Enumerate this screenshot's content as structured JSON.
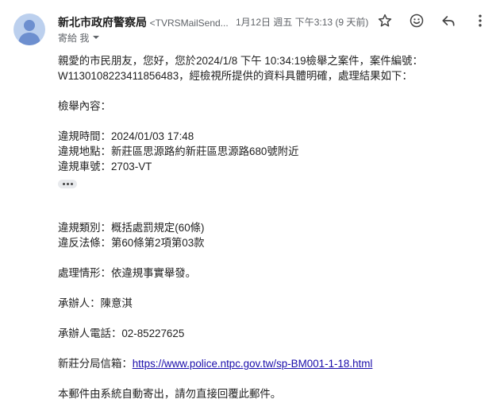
{
  "header": {
    "sender_name": "新北市政府警察局",
    "sender_email": "<TVRSMailSend...",
    "date": "1月12日 週五 下午3:13 (9 天前)",
    "to_label": "寄給 我",
    "icons": [
      "star-icon",
      "emoji-icon",
      "reply-icon",
      "more-vert-icon"
    ]
  },
  "body": {
    "greeting_line1": "親愛的市民朋友，您好，您於2024/1/8 下午 10:34:19檢舉之案件，案件編號：",
    "greeting_line2": "W1130108223411856483，經檢視所提供的資料具體明確，處理結果如下：",
    "report_heading": "檢舉內容：",
    "violation_time": "違規時間：2024/01/03 17:48",
    "violation_location": "違規地點：新莊區思源路約新莊區思源路680號附近",
    "violation_plate": "違規車號：2703-VT",
    "violation_category": "違規類別：概括處罰規定(60條)",
    "violation_law": "違反法條：第60條第2項第03款",
    "handling": "處理情形：依違規事實舉發。",
    "handler": "承辦人：陳意淇",
    "handler_phone": "承辦人電話：02-85227625",
    "branch_mailbox_label": "新莊分局信箱：",
    "branch_mailbox_url": "https://www.police.ntpc.gov.tw/sp-BM001-1-18.html",
    "footer_note": "本郵件由系統自動寄出，請勿直接回覆此郵件。"
  }
}
